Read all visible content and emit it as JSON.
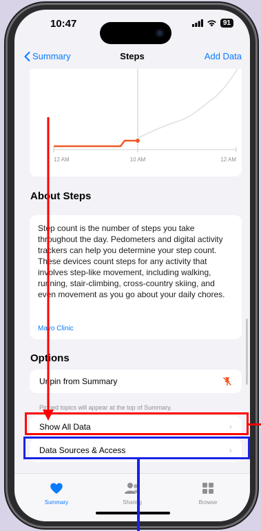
{
  "status": {
    "time": "10:47",
    "battery": "91"
  },
  "nav": {
    "back_label": "Summary",
    "title": "Steps",
    "add_label": "Add Data"
  },
  "chart": {
    "x_ticks": [
      "12 AM",
      "10 AM",
      "12 AM"
    ]
  },
  "chart_data": {
    "type": "line",
    "x_ticks": [
      "12 AM",
      "10 AM",
      "12 AM"
    ],
    "series": [
      {
        "values_note": "",
        "x": [
          "00:00",
          "06:00",
          "06:30",
          "10:00"
        ],
        "y": [
          0,
          0,
          1,
          1
        ]
      }
    ]
  },
  "about": {
    "heading": "About Steps",
    "body": "Step count is the number of steps you take throughout the day. Pedometers and digital activity trackers can help you determine your step count. These devices count steps for any activity that involves step-like movement, including walking, running, stair-climbing, cross-country skiing, and even movement as you go about your daily chores.",
    "source": "Mayo Clinic"
  },
  "options": {
    "heading": "Options",
    "unpin_label": "Unpin from Summary",
    "pin_footnote": "Pinned topics will appear at the top of Summary.",
    "show_all_label": "Show All Data",
    "sources_label": "Data Sources & Access"
  },
  "tabs": [
    {
      "label": "Summary",
      "active": true
    },
    {
      "label": "Sharing",
      "active": false
    },
    {
      "label": "Browse",
      "active": false
    }
  ],
  "colors": {
    "accent": "#0a7aff",
    "steps": "#f05a28",
    "highlight_red": "#ff0000",
    "highlight_blue": "#1a22e6"
  }
}
